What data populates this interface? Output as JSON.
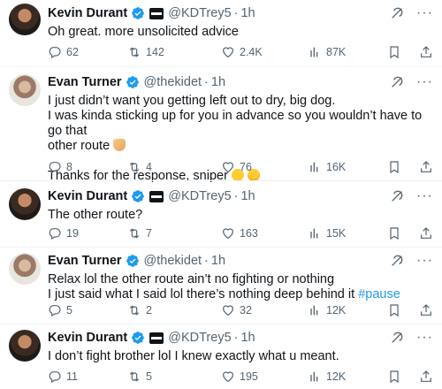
{
  "tweets": [
    {
      "author": "Kevin Durant",
      "handle": "@KDTrey5",
      "sep": "·",
      "time": "1h",
      "lines": [
        "Oh great. more unsolicited advice"
      ],
      "replies": "62",
      "retweets": "142",
      "likes": "2.4K",
      "views": "87K"
    },
    {
      "author": "Evan Turner",
      "handle": "@thekidet",
      "sep": "·",
      "time": "1h",
      "lines": [
        "I just didn’t want you getting left out to dry, big dog.",
        "I was kinda sticking up for you in advance so you wouldn’t have to go that",
        "other route",
        "",
        "Thanks for the response, sniper"
      ],
      "replies": "8",
      "retweets": "4",
      "likes": "76",
      "views": "16K"
    },
    {
      "author": "Kevin Durant",
      "handle": "@KDTrey5",
      "sep": "·",
      "time": "1h",
      "lines": [
        "The other route?"
      ],
      "replies": "19",
      "retweets": "7",
      "likes": "163",
      "views": "15K"
    },
    {
      "author": "Evan Turner",
      "handle": "@thekidet",
      "sep": "·",
      "time": "1h",
      "lines": [
        "Relax lol the other route ain’t no fighting or nothing",
        "I just said what I said lol there’s nothing deep behind it",
        "#pause"
      ],
      "replies": "5",
      "retweets": "2",
      "likes": "32",
      "views": "12K"
    },
    {
      "author": "Kevin Durant",
      "handle": "@KDTrey5",
      "sep": "·",
      "time": "1h",
      "lines": [
        "I don’t fight brother lol I knew exactly what u meant."
      ],
      "replies": "11",
      "retweets": "5",
      "likes": "195",
      "views": "12K"
    }
  ],
  "icons": {
    "more": "···",
    "accent": "#1d9bf0",
    "muted": "#536471"
  }
}
